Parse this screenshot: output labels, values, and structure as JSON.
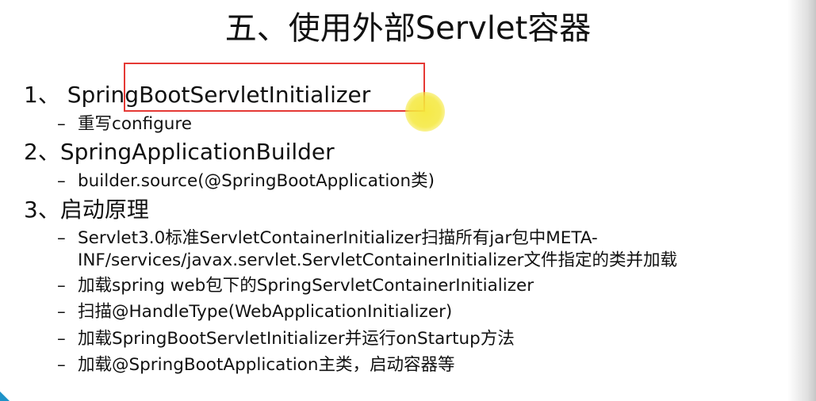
{
  "slide": {
    "title": "五、使用外部Servlet容器",
    "sections": [
      {
        "heading": "1、 SpringBootServletInitializer",
        "bullets": [
          "重写configure"
        ]
      },
      {
        "heading": "2、SpringApplicationBuilder",
        "bullets": [
          "builder.source(@SpringBootApplication类)"
        ]
      },
      {
        "heading": "3、启动原理",
        "bullets": [
          "Servlet3.0标准ServletContainerInitializer扫描所有jar包中META-",
          "INF/services/javax.servlet.ServletContainerInitializer文件指定的类并加载",
          "加载spring web包下的SpringServletContainerInitializer",
          "扫描@HandleType(WebApplicationInitializer)",
          "加载SpringBootServletInitializer并运行onStartup方法",
          "加载@SpringBootApplication主类，启动容器等"
        ]
      }
    ],
    "dash": "–"
  },
  "colors": {
    "highlight_border": "#e53935",
    "cursor": "#f5e83c",
    "corner": "#1e93c8"
  }
}
